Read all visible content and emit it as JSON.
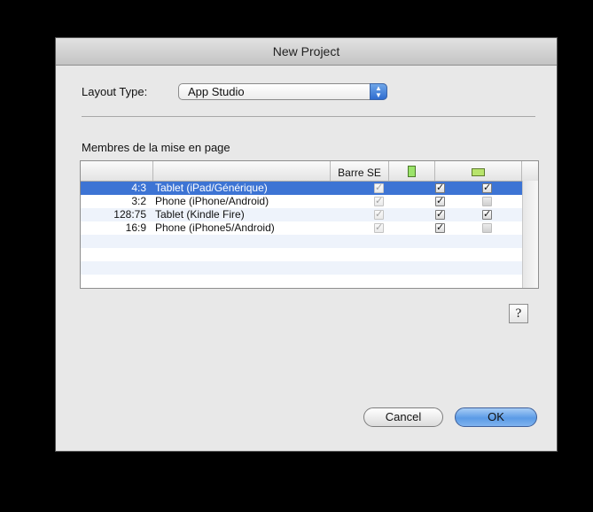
{
  "dialog": {
    "title": "New Project"
  },
  "layout_type": {
    "label": "Layout Type:",
    "value": "App Studio"
  },
  "section_label": "Membres de la mise en page",
  "table": {
    "headers": [
      "",
      "",
      "Barre SE",
      "portrait-icon",
      "landscape-icon"
    ],
    "rows": [
      {
        "ratio": "4:3",
        "name": "Tablet (iPad/Générique)",
        "barre_se": "checked-disabled",
        "portrait": "checked",
        "landscape": "checked"
      },
      {
        "ratio": "3:2",
        "name": "Phone (iPhone/Android)",
        "barre_se": "checked-disabled",
        "portrait": "checked",
        "landscape": "unchecked"
      },
      {
        "ratio": "128:75",
        "name": "Tablet (Kindle Fire)",
        "barre_se": "checked-disabled",
        "portrait": "checked",
        "landscape": "checked"
      },
      {
        "ratio": "16:9",
        "name": "Phone (iPhone5/Android)",
        "barre_se": "checked-disabled",
        "portrait": "checked",
        "landscape": "unchecked"
      }
    ],
    "selected_row": 0
  },
  "help_label": "?",
  "buttons": {
    "cancel": "Cancel",
    "ok": "OK"
  },
  "colors": {
    "selection": "#3d74d4",
    "portrait_icon": "#9be36a",
    "landscape_icon": "#b8e46c"
  }
}
